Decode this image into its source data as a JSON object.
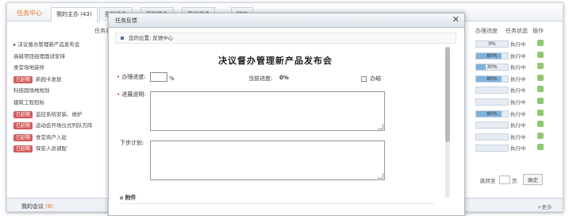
{
  "background": {
    "tab_title": "任务中心",
    "tabs": [
      {
        "label": "我的主办 (43)"
      },
      {
        "label": "我的协办"
      },
      {
        "label": "我的督办"
      },
      {
        "label": "我的关注"
      },
      {
        "label": "排序"
      }
    ],
    "task_col_header": "任务名称",
    "rows": [
      {
        "badge": "",
        "name": "决议督办管理新产品发布会"
      },
      {
        "badge": "",
        "name": "高级项目经理面试安排"
      },
      {
        "badge": "",
        "name": "食堂场地装修"
      },
      {
        "badge": "已延期",
        "name": "新园卡发放"
      },
      {
        "badge": "",
        "name": "科技园场地规划"
      },
      {
        "badge": "",
        "name": "建筑工程招标"
      },
      {
        "badge": "已延期",
        "name": "监控系统安装、维护"
      },
      {
        "badge": "已延期",
        "name": "运动会开场仪式列队方阵"
      },
      {
        "badge": "已延期",
        "name": "食堂商户入驻"
      },
      {
        "badge": "已延期",
        "name": "保安人员调配"
      }
    ],
    "right_headers": {
      "progress": "办理进度",
      "status": "任务状态",
      "op": "操作"
    },
    "right_rows": [
      {
        "progress_label": "0%",
        "progress": 0,
        "status": "执行中"
      },
      {
        "progress_label": "80%",
        "progress": 80,
        "status": "执行中"
      },
      {
        "progress_label": "30%",
        "progress": 30,
        "status": "执行中"
      },
      {
        "progress_label": "80%",
        "progress": 80,
        "status": "执行中"
      },
      {
        "progress_label": "",
        "progress": 0,
        "status": "执行中"
      },
      {
        "progress_label": "",
        "progress": 0,
        "status": "执行中"
      },
      {
        "progress_label": "80%",
        "progress": 80,
        "status": "执行中"
      },
      {
        "progress_label": "",
        "progress": 0,
        "status": "执行中"
      },
      {
        "progress_label": "",
        "progress": 0,
        "status": "执行中"
      },
      {
        "progress_label": "",
        "progress": 0,
        "status": "执行中"
      }
    ],
    "pager": {
      "jump_label": "跳转至",
      "page_unit": "页",
      "confirm": "确定"
    },
    "bottom_label": "我的会议",
    "bottom_count": "(6)",
    "more": "+更多"
  },
  "dialog": {
    "title": "任务反馈",
    "location": "您的位置: 反馈中心",
    "heading": "决议督办管理新产品发布会",
    "progress_label": "办理进度:",
    "progress_unit": "%",
    "current_progress_label": "当前进度:",
    "current_progress_value": "0%",
    "done_label": "办结",
    "explain_label": "进展说明:",
    "next_plan_label": "下步计划:",
    "attachment_label": "附件"
  },
  "colors": {
    "accent": "#e0762b",
    "badge": "#d25b5b",
    "progress": "#7fb3de"
  }
}
